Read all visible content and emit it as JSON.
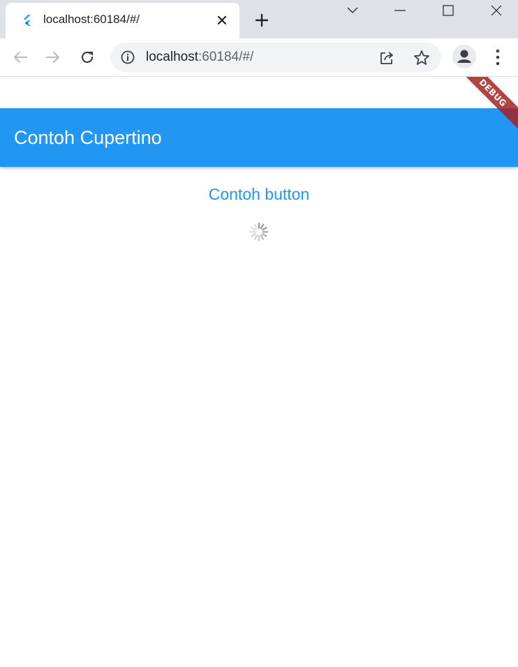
{
  "browser": {
    "tab_title": "localhost:60184/#/",
    "url_host": "localhost",
    "url_path": ":60184/#/"
  },
  "app": {
    "appbar_title": "Contoh Cupertino",
    "button_label": "Contoh button",
    "debug_banner": "DEBUG",
    "accent_color": "#2196f3",
    "banner_color": "#a32323"
  }
}
